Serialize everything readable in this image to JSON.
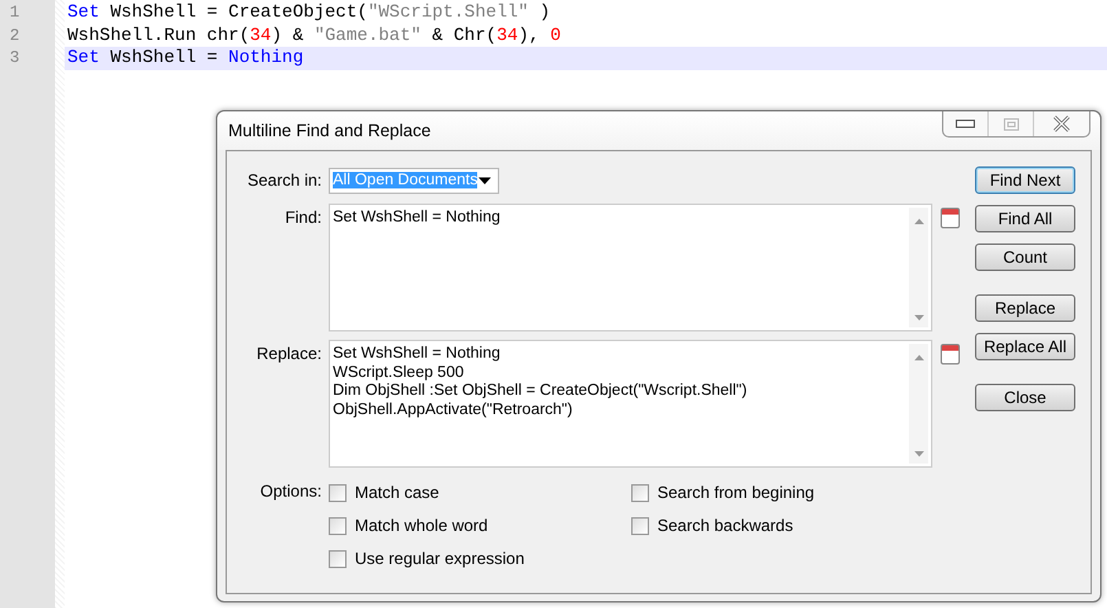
{
  "editor": {
    "lines": [
      {
        "number": "1",
        "current": false,
        "tokens": [
          {
            "kind": "keyword",
            "text": "Set"
          },
          {
            "kind": "plain",
            "text": " WshShell = CreateObject("
          },
          {
            "kind": "string",
            "text": "\"WScript.Shell\""
          },
          {
            "kind": "plain",
            "text": " )"
          }
        ]
      },
      {
        "number": "2",
        "current": false,
        "tokens": [
          {
            "kind": "plain",
            "text": "WshShell.Run chr("
          },
          {
            "kind": "number",
            "text": "34"
          },
          {
            "kind": "plain",
            "text": ") & "
          },
          {
            "kind": "string",
            "text": "\"Game.bat\""
          },
          {
            "kind": "plain",
            "text": " & Chr("
          },
          {
            "kind": "number",
            "text": "34"
          },
          {
            "kind": "plain",
            "text": "), "
          },
          {
            "kind": "number",
            "text": "0"
          }
        ]
      },
      {
        "number": "3",
        "current": true,
        "tokens": [
          {
            "kind": "keyword",
            "text": "Set"
          },
          {
            "kind": "plain",
            "text": " WshShell = "
          },
          {
            "kind": "keyword",
            "text": "Nothing"
          }
        ]
      }
    ]
  },
  "dialog": {
    "title": "Multiline Find and Replace",
    "search_in": {
      "label": "Search in:",
      "value": "All Open Documents",
      "highlighted": true
    },
    "find": {
      "label": "Find:",
      "value": "Set WshShell = Nothing"
    },
    "replace": {
      "label": "Replace:",
      "value": "Set WshShell = Nothing\nWScript.Sleep 500\nDim ObjShell :Set ObjShell = CreateObject(\"Wscript.Shell\")\nObjShell.AppActivate(\"Retroarch\")"
    },
    "options_label": "Options:",
    "options": [
      {
        "label": "Match case",
        "checked": false
      },
      {
        "label": "Search from begining",
        "checked": false
      },
      {
        "label": "Match whole word",
        "checked": false
      },
      {
        "label": "Search backwards",
        "checked": false
      },
      {
        "label": "Use regular expression",
        "checked": false
      }
    ],
    "button_groups": [
      [
        {
          "label": "Find Next",
          "default": true
        },
        {
          "label": "Find All",
          "default": false
        },
        {
          "label": "Count",
          "default": false
        }
      ],
      [
        {
          "label": "Replace",
          "default": false
        },
        {
          "label": "Replace All",
          "default": false
        }
      ],
      [
        {
          "label": "Close",
          "default": false
        }
      ]
    ]
  }
}
